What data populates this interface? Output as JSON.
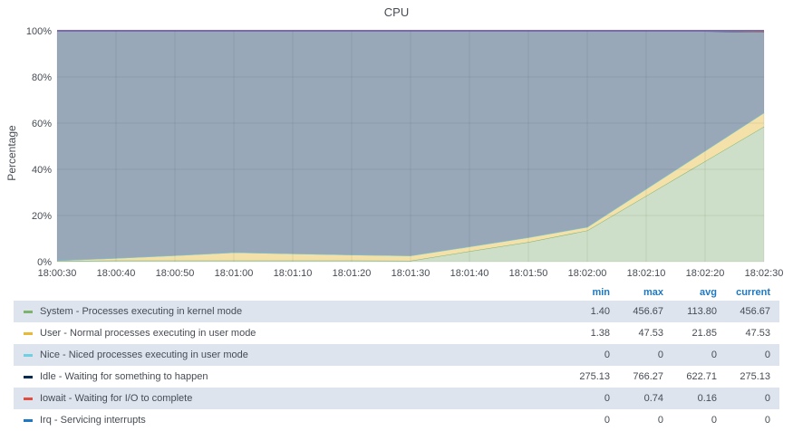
{
  "panel": {
    "title": "CPU"
  },
  "chart_data": {
    "type": "area",
    "stacked": true,
    "title": "CPU",
    "ylabel": "Percentage",
    "ylim": [
      0,
      100
    ],
    "y_ticks": [
      "0%",
      "20%",
      "40%",
      "60%",
      "80%",
      "100%"
    ],
    "x": [
      "18:00:30",
      "18:00:40",
      "18:00:50",
      "18:01:00",
      "18:01:10",
      "18:01:20",
      "18:01:30",
      "18:01:40",
      "18:01:50",
      "18:02:00",
      "18:02:10",
      "18:02:20",
      "18:02:30"
    ],
    "x_ticks": [
      "18:00:30",
      "18:00:40",
      "18:00:50",
      "18:01:00",
      "18:01:10",
      "18:01:20",
      "18:01:30",
      "18:01:40",
      "18:01:50",
      "18:02:00",
      "18:02:10",
      "18:02:20",
      "18:02:30"
    ],
    "grid": true,
    "series": [
      {
        "name": "System - Processes executing in kernel mode",
        "color": "#7eb26d",
        "fill": "#cddfc8",
        "values": [
          0.3,
          0.5,
          0.5,
          0.5,
          0.5,
          0.5,
          0.4,
          4.5,
          8.5,
          13.5,
          28.5,
          43.5,
          58.5
        ]
      },
      {
        "name": "User - Normal processes executing in user mode",
        "color": "#eab839",
        "fill": "#f3e1a9",
        "values": [
          0.2,
          1.0,
          2.2,
          3.5,
          3.0,
          2.5,
          2.2,
          2.0,
          2.0,
          1.5,
          3.0,
          4.5,
          6.0
        ]
      },
      {
        "name": "Nice - Niced processes executing in user mode",
        "color": "#6ed0e0",
        "fill": "#c6ecf2",
        "values": [
          0,
          0,
          0,
          0,
          0,
          0,
          0,
          0,
          0,
          0,
          0,
          0,
          0
        ]
      },
      {
        "name": "Idle - Waiting for something to happen",
        "color": "#052b51",
        "fill": "#98a8b8",
        "values": [
          99.3,
          98.3,
          97.1,
          95.8,
          96.3,
          96.8,
          97.2,
          93.3,
          89.3,
          84.8,
          68.3,
          51.8,
          35.0
        ]
      },
      {
        "name": "Iowait - Waiting for I/O to complete",
        "color": "#ef843c",
        "fill": "#f8c9a9",
        "values": [
          0,
          0,
          0,
          0,
          0,
          0,
          0,
          0,
          0,
          0,
          0,
          0.1,
          0.1
        ]
      },
      {
        "name": "Irq - Servicing interrupts",
        "color": "#806eb7",
        "fill": "#a89bd0",
        "values": [
          0.2,
          0.2,
          0.2,
          0.2,
          0.2,
          0.2,
          0.2,
          0.2,
          0.2,
          0.2,
          0.2,
          0.1,
          0.4
        ]
      }
    ]
  },
  "legend": {
    "columns": [
      "min",
      "max",
      "avg",
      "current"
    ],
    "rows": [
      {
        "name": "System - Processes executing in kernel mode",
        "color": "#7eb26d",
        "min": "1.40",
        "max": "456.67",
        "avg": "113.80",
        "current": "456.67"
      },
      {
        "name": "User - Normal processes executing in user mode",
        "color": "#eab839",
        "min": "1.38",
        "max": "47.53",
        "avg": "21.85",
        "current": "47.53"
      },
      {
        "name": "Nice - Niced processes executing in user mode",
        "color": "#6ed0e0",
        "min": "0",
        "max": "0",
        "avg": "0",
        "current": "0"
      },
      {
        "name": "Idle - Waiting for something to happen",
        "color": "#052b51",
        "min": "275.13",
        "max": "766.27",
        "avg": "622.71",
        "current": "275.13"
      },
      {
        "name": "Iowait - Waiting for I/O to complete",
        "color": "#e24d42",
        "min": "0",
        "max": "0.74",
        "avg": "0.16",
        "current": "0"
      },
      {
        "name": "Irq - Servicing interrupts",
        "color": "#1f78c1",
        "min": "0",
        "max": "0",
        "avg": "0",
        "current": "0"
      }
    ]
  }
}
